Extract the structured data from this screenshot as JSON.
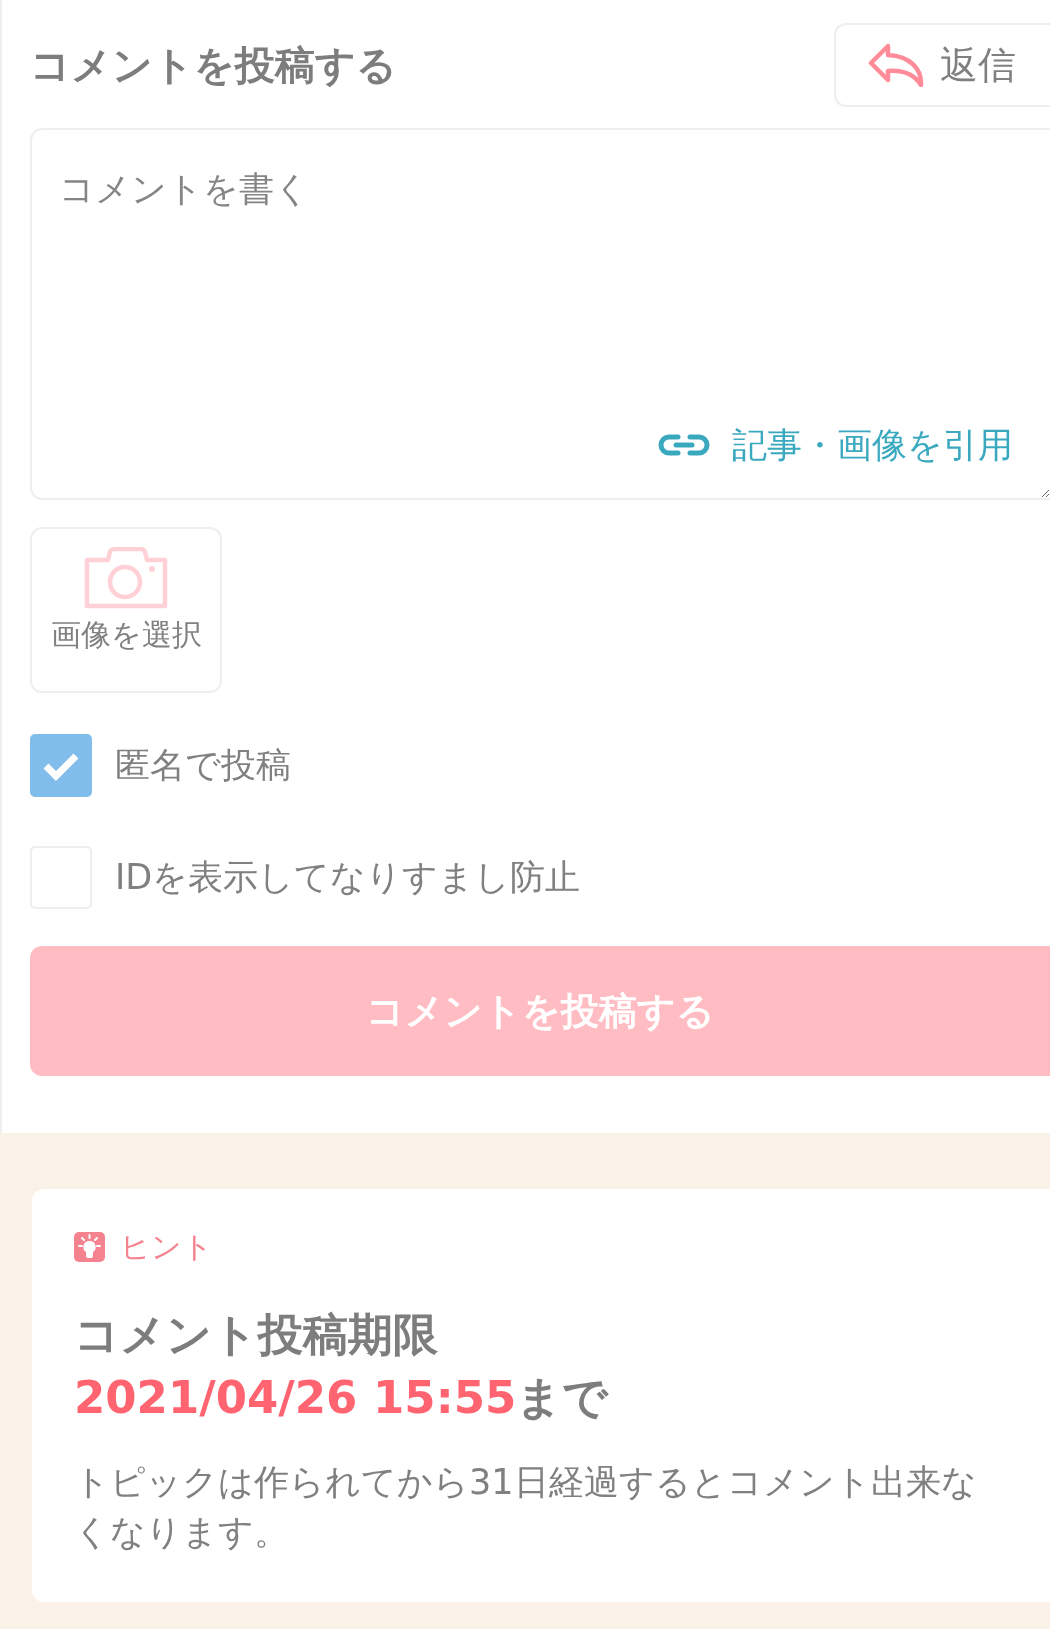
{
  "header": {
    "title": "コメントを投稿する",
    "reply_button": "返信"
  },
  "comment_box": {
    "placeholder": "コメントを書く",
    "quote_link": "記事・画像を引用"
  },
  "image_button": {
    "label": "画像を選択"
  },
  "options": [
    {
      "label": "匿名で投稿",
      "checked": true
    },
    {
      "label": "IDを表示してなりすまし防止",
      "checked": false
    }
  ],
  "submit_button": {
    "label": "コメントを投稿する",
    "disabled": true
  },
  "hint": {
    "label": "ヒント",
    "title": "コメント投稿期限",
    "deadline": "2021/04/26 15:55",
    "deadline_suffix": "まで",
    "note": "トピックは作られてから31日経過するとコメント出来なくなります。"
  }
}
